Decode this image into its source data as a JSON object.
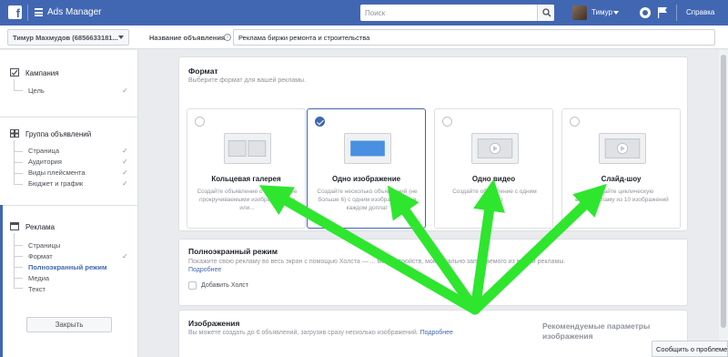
{
  "topbar": {
    "app_title": "Ads Manager",
    "search_placeholder": "Поиск",
    "user_name": "Тимур",
    "help_label": "Справка"
  },
  "subheader": {
    "account_name": "Тимур Махмудов (6856633181...",
    "ad_name_label": "Название объявления",
    "ad_name_value": "Реклама биржи ремонта и строительства"
  },
  "sidebar": {
    "sections": [
      {
        "title": "Кампания",
        "items": [
          "Цель"
        ]
      },
      {
        "title": "Группа объявлений",
        "items": [
          "Страница",
          "Аудитория",
          "Виды плейсмента",
          "Бюджет и график"
        ]
      },
      {
        "title": "Реклама",
        "items": [
          "Страницы",
          "Формат",
          "Полноэкранный режим",
          "Медиа",
          "Текст"
        ]
      }
    ],
    "close_label": "Закрыть"
  },
  "format_panel": {
    "title": "Формат",
    "subtitle": "Выберите формат для вашей рекламы.",
    "cards": [
      {
        "title": "Кольцевая галерея",
        "desc": "Создайте объявление с 2 или более прокручиваемыми изображениями или..."
      },
      {
        "title": "Одно изображение",
        "desc": "Создайте несколько объявлений (не больше 6) с одним изображением в каждом доплат"
      },
      {
        "title": "Одно видео",
        "desc": "Создайте объявление с одним видео"
      },
      {
        "title": "Слайд-шоу",
        "desc": "Создайте циклическую видеорекламу из 10 изображений"
      }
    ]
  },
  "fullscreen_panel": {
    "title": "Полноэкранный режим",
    "desc": "Покажите свою рекламу во весь экран с помощью Холста — ... моб. устройств, моментально запускаемого из вашей рекламы.",
    "more_link": "Подробнее",
    "checkbox_label": "Добавить Холст"
  },
  "images_panel": {
    "title": "Изображения",
    "desc": "Вы можете создать до 6 объявлений, загрузив сразу несколько изображений.",
    "more_link": "Подробнее",
    "recommended_title": "Рекомендуемые параметры изображения"
  },
  "report_button": "Сообщить о проблеме",
  "colors": {
    "brand": "#4267b2",
    "arrow": "#2ee62e"
  }
}
